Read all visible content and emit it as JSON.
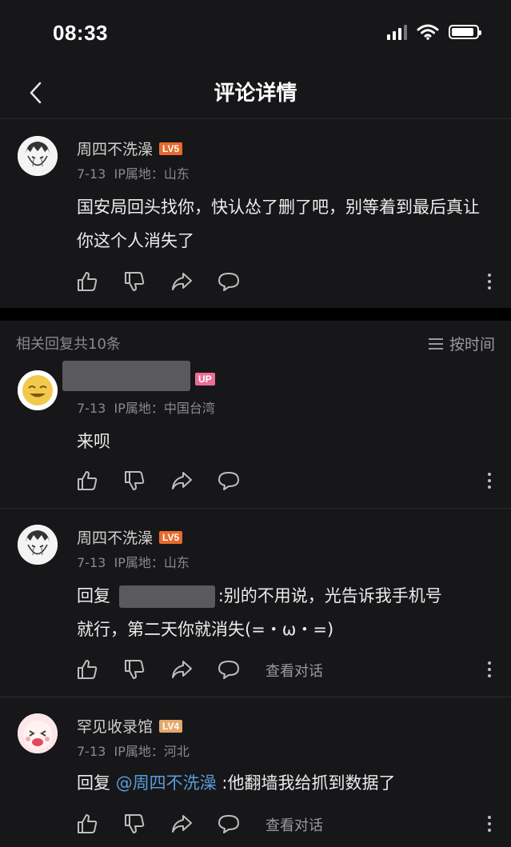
{
  "status_bar": {
    "time": "08:33"
  },
  "nav": {
    "title": "评论详情"
  },
  "main_comment": {
    "user": "周四不洗澡",
    "level": "LV5",
    "date": "7-13",
    "ip": "IP属地：山东",
    "text": "国安局回头找你，快认怂了删了吧，别等着到最后真让你这个人消失了"
  },
  "replies_header": {
    "count_label": "相关回复共10条",
    "sort_label": "按时间"
  },
  "replies": [
    {
      "user_badge": "UP",
      "date": "7-13",
      "ip": "IP属地：中国台湾",
      "text": "来呗"
    },
    {
      "user": "周四不洗澡",
      "level": "LV5",
      "date": "7-13",
      "ip": "IP属地：山东",
      "reply_prefix": "回复",
      "text_line1": ":别的不用说，光告诉我手机号",
      "text_line2": "就行，第二天你就消失(=・ω・=)",
      "view_convo": "查看对话"
    },
    {
      "user": "罕见收录馆",
      "level": "LV4",
      "date": "7-13",
      "ip": "IP属地：河北",
      "reply_prefix": "回复",
      "mention": "@周四不洗澡",
      "text": ":他翻墙我给抓到数据了",
      "view_convo": "查看对话"
    }
  ],
  "colors": {
    "background": "#17171a",
    "mention": "#5a9bd6",
    "level5": "#e86a2c",
    "level4": "#e3a96b",
    "up_badge": "#ea6d97"
  }
}
